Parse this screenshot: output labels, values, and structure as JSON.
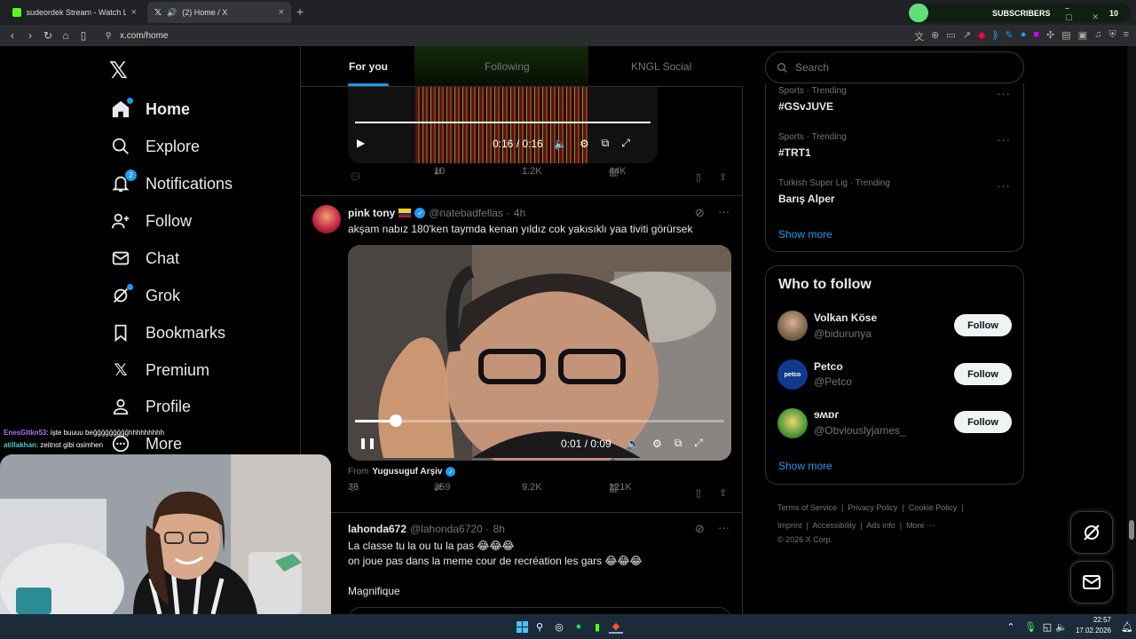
{
  "browser": {
    "tabs": [
      {
        "title": "sudeordek Stream - Watch Live o",
        "active": false
      },
      {
        "title": "(2) Home / X",
        "active": true
      }
    ],
    "url": "x.com/home",
    "subscribers_label": "SUBSCRIBERS",
    "subscribers_count": "10",
    "subscribers_progress": 0.08
  },
  "nav": {
    "items": [
      {
        "label": "Home",
        "icon": "home-icon"
      },
      {
        "label": "Explore",
        "icon": "search-icon"
      },
      {
        "label": "Notifications",
        "icon": "bell-icon",
        "badge": "2"
      },
      {
        "label": "Follow",
        "icon": "person-plus-icon"
      },
      {
        "label": "Chat",
        "icon": "envelope-icon"
      },
      {
        "label": "Grok",
        "icon": "grok-icon"
      },
      {
        "label": "Bookmarks",
        "icon": "bookmark-icon"
      },
      {
        "label": "Premium",
        "icon": "x-logo-icon"
      },
      {
        "label": "Profile",
        "icon": "person-icon"
      },
      {
        "label": "More",
        "icon": "more-circle-icon"
      }
    ]
  },
  "feed": {
    "tabs": [
      "For you",
      "Following",
      "KNGL Social"
    ],
    "post1": {
      "video_time": "0:16 / 0:16",
      "replies": "",
      "reposts": "10",
      "likes": "1.2K",
      "views": "44K"
    },
    "post2": {
      "name": "pink tony",
      "handle": "@natebadfellas",
      "time": "4h",
      "text": "akşam nabız 180'ken taymda kenan yıldız cok yakısıklı yaa tiviti görürsek",
      "video_time": "0:01 / 0:09",
      "video_progress": 0.11,
      "from_label": "From",
      "from_name": "Yugusuguf Arşiv",
      "replies": "36",
      "reposts": "359",
      "likes": "9.2K",
      "views": "121K"
    },
    "post3": {
      "name": "lahonda672",
      "handle": "@lahonda6720",
      "time": "8h",
      "line1": "La classe tu la ou tu la pas 😂😂😂",
      "line2": "on joue pas dans la meme cour de recréation les gars 😂😂😂",
      "line3": "Magnifique"
    }
  },
  "right": {
    "search_placeholder": "Search",
    "trends": [
      {
        "meta": "Sports · Trending",
        "name": "#GSvJUVE"
      },
      {
        "meta": "Sports · Trending",
        "name": "#TRT1"
      },
      {
        "meta": "Turkish Super Lig · Trending",
        "name": "Barış Alper"
      }
    ],
    "trends_show_more": "Show more",
    "who_to_follow_title": "Who to follow",
    "follow_suggestions": [
      {
        "name": "Volkan Köse",
        "handle": "@bidurunya",
        "button": "Follow"
      },
      {
        "name": "Petco",
        "handle": "@Petco",
        "button": "Follow",
        "avatar_text": "petco"
      },
      {
        "name": "ɘʍɒɾ",
        "handle": "@Obviouslyjames_",
        "button": "Follow"
      }
    ],
    "follow_show_more": "Show more",
    "footer_links": [
      "Terms of Service",
      "Privacy Policy",
      "Cookie Policy",
      "Imprint",
      "Accessibility",
      "Ads info",
      "More ···"
    ],
    "copyright": "© 2026 X Corp."
  },
  "stream": {
    "chat": [
      {
        "user": "EnesGltkn53",
        "text": ": işte buuuu beğğğğğğğğğhhhhhhhhh",
        "color": "#b36bff"
      },
      {
        "user": "atillakhan",
        "text": ": zeitnot gibi osimhen",
        "color": "#4ec9c9"
      }
    ]
  },
  "taskbar": {
    "time": "22:57",
    "date": "17.02.2026"
  }
}
